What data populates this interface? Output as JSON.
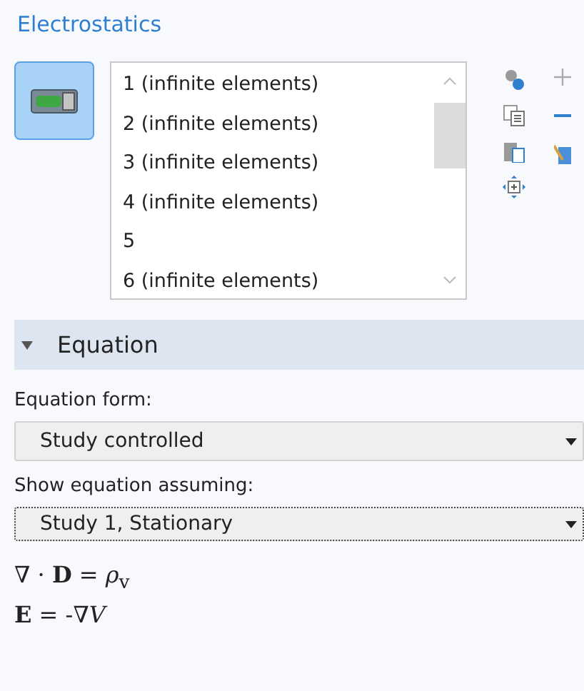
{
  "title": "Electrostatics",
  "selection_toggle": {
    "on": true
  },
  "selection_list": [
    {
      "label": "1 (infinite elements)",
      "selected": false
    },
    {
      "label": "2 (infinite elements)",
      "selected": false
    },
    {
      "label": "3 (infinite elements)",
      "selected": false
    },
    {
      "label": "4 (infinite elements)",
      "selected": false
    },
    {
      "label": "5",
      "selected": false
    },
    {
      "label": "6 (infinite elements)",
      "selected": false
    }
  ],
  "section": {
    "label": "Equation",
    "expanded": true
  },
  "fields": [
    {
      "label": "Equation form:",
      "value": "Study controlled",
      "focused": false
    },
    {
      "label": "Show equation assuming:",
      "value": "Study 1, Stationary",
      "focused": true
    }
  ],
  "equations": [
    "∇ · **D** = *ρ*$_{v}$",
    "**E** = -∇*V*"
  ]
}
